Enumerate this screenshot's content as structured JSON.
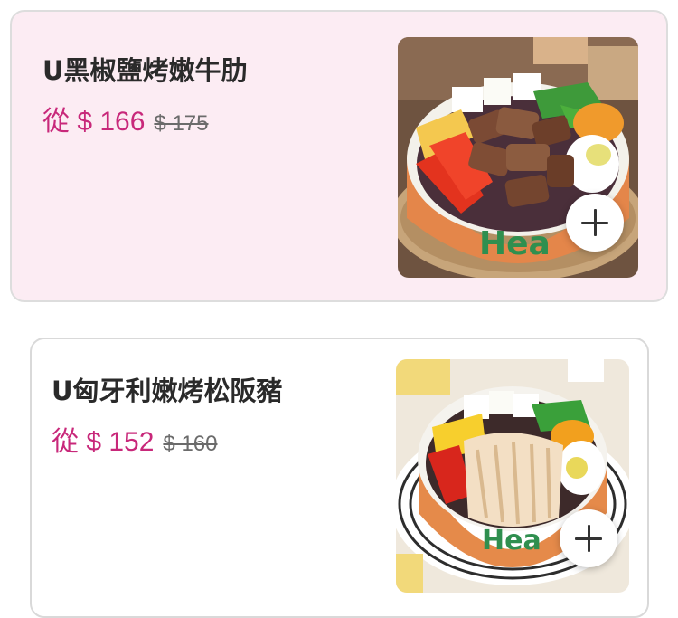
{
  "menu_items": [
    {
      "name": "U黑椒鹽烤嫩牛肋",
      "price": "從 $ 166",
      "original_price": "$ 175",
      "image_icon": "beef-rice-bowl-photo",
      "add_icon": "plus-icon"
    },
    {
      "name": "U匈牙利嫩烤松阪豬",
      "price": "從 $ 152",
      "original_price": "$ 160",
      "image_icon": "pork-rice-bowl-photo",
      "add_icon": "plus-icon"
    }
  ],
  "colors": {
    "price": "#c8287a",
    "highlight_bg": "#fcecf3",
    "title": "#2a2a2a"
  }
}
